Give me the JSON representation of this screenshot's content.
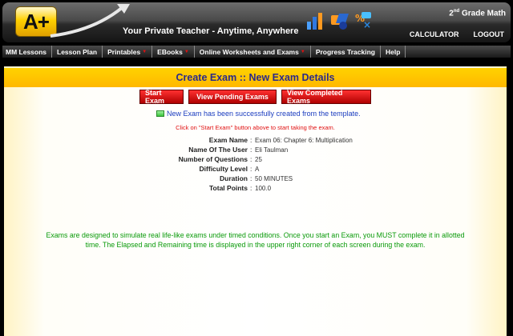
{
  "header": {
    "logo_text": "A+",
    "tagline": "Your Private Teacher - Anytime, Anywhere",
    "grade_num": "2",
    "grade_sup": "nd",
    "grade_rest": " Grade Math",
    "links": [
      "CALCULATOR",
      "LOGOUT"
    ]
  },
  "nav": {
    "items": [
      {
        "label": "MM Lessons",
        "dropdown": false
      },
      {
        "label": "Lesson Plan",
        "dropdown": false
      },
      {
        "label": "Printables",
        "dropdown": true
      },
      {
        "label": "EBooks",
        "dropdown": true
      },
      {
        "label": "Online Worksheets and Exams",
        "dropdown": true
      },
      {
        "label": "Progress Tracking",
        "dropdown": false
      },
      {
        "label": "Help",
        "dropdown": false
      }
    ]
  },
  "panel": {
    "title": "Create Exam :: New Exam Details",
    "buttons": {
      "start": "Start Exam",
      "pending": "View Pending Exams",
      "completed": "View Completed Exams"
    },
    "success_message": "New Exam has been successfully created from the template.",
    "instruction": "Click on \"Start Exam\" button above to start taking the exam.",
    "details": [
      {
        "label": "Exam Name",
        "value": "Exam 06: Chapter 6: Multiplication"
      },
      {
        "label": "Name Of The User",
        "value": "Eli Taulman"
      },
      {
        "label": "Number of Questions",
        "value": "25"
      },
      {
        "label": "Difficulty Level",
        "value": "A"
      },
      {
        "label": "Duration",
        "value": "50 MINUTES"
      },
      {
        "label": "Total Points",
        "value": "100.0"
      }
    ],
    "footer_note": "Exams are designed to simulate real life-like exams under timed conditions. Once you start an Exam, you MUST complete it in allotted time. The Elapsed and Remaining time is displayed in the upper right corner of each screen during the exam."
  },
  "colors": {
    "accent_yellow": "#ffc800",
    "button_red": "#d01010",
    "title_blue": "#2a2a8a",
    "note_green": "#0a9a0a"
  }
}
